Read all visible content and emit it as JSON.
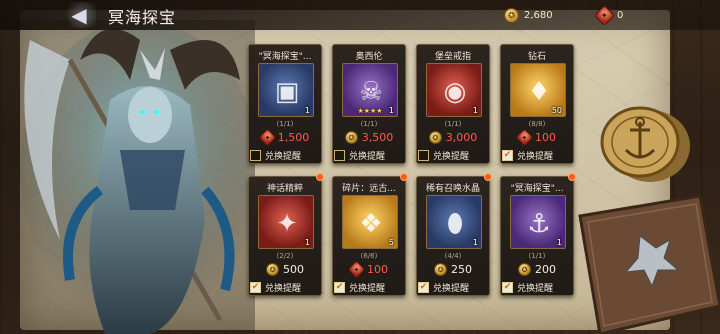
{
  "header": {
    "back_label": "◀",
    "title": "冥海探宝"
  },
  "currencies": {
    "gold": {
      "icon": "gold-coin-icon",
      "value": "2,680",
      "color": "#d4a23a"
    },
    "red": {
      "icon": "red-token-icon",
      "value": "0",
      "color": "#c23a24"
    }
  },
  "shop": {
    "items": [
      {
        "name": "\"冥海探宝\"...",
        "icon": "blue-chest-icon",
        "qty": "1",
        "stars": "",
        "limit": "(1/1)",
        "price": "1,500",
        "currency": "red",
        "price_color": "red",
        "remind": false,
        "badge": false
      },
      {
        "name": "奥西伦",
        "icon": "hero-portrait-icon",
        "qty": "1",
        "stars": "★★★★",
        "limit": "(1/1)",
        "price": "3,500",
        "currency": "gold",
        "price_color": "red",
        "remind": false,
        "badge": false
      },
      {
        "name": "堡垒戒指",
        "icon": "ring-icon",
        "qty": "1",
        "stars": "",
        "limit": "(1/1)",
        "price": "3,000",
        "currency": "gold",
        "price_color": "red",
        "remind": false,
        "badge": false
      },
      {
        "name": "钻石",
        "icon": "diamond-icon",
        "qty": "50",
        "stars": "",
        "limit": "(8/8)",
        "price": "100",
        "currency": "red",
        "price_color": "red",
        "remind": true,
        "badge": false
      },
      {
        "name": "神话精粹",
        "icon": "essence-icon",
        "qty": "1",
        "stars": "",
        "limit": "(2/2)",
        "price": "500",
        "currency": "gold",
        "price_color": "white",
        "remind": true,
        "badge": true
      },
      {
        "name": "碎片：远古...",
        "icon": "fragment-icon",
        "qty": "5",
        "stars": "",
        "limit": "(6/6)",
        "price": "100",
        "currency": "red",
        "price_color": "red",
        "remind": true,
        "badge": true
      },
      {
        "name": "稀有召唤水晶",
        "icon": "crystal-icon",
        "qty": "1",
        "stars": "",
        "limit": "(4/4)",
        "price": "250",
        "currency": "gold",
        "price_color": "white",
        "remind": true,
        "badge": true
      },
      {
        "name": "\"冥海探宝\"...",
        "icon": "rune-chest-icon",
        "qty": "1",
        "stars": "",
        "limit": "(1/1)",
        "price": "200",
        "currency": "gold",
        "price_color": "white",
        "remind": true,
        "badge": true
      }
    ],
    "remind_label": "兑换提醒"
  }
}
